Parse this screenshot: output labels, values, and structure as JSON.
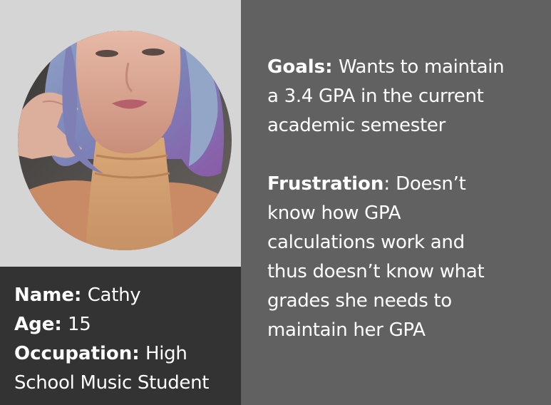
{
  "persona": {
    "name_label": "Name:",
    "name_value": "Cathy",
    "age_label": "Age:",
    "age_value": "15",
    "occupation_label": "Occupation:",
    "occupation_value_line1": "High",
    "occupation_value_line2": "School Music Student"
  },
  "goals": {
    "label": "Goals:",
    "line1": "Wants to maintain",
    "line2": "a 3.4 GPA in the current",
    "line3": "academic semester"
  },
  "frustration": {
    "label": "Frustration",
    "colon": ":",
    "line1": "Doesn’t",
    "line2": "know how GPA",
    "line3": "calculations work and",
    "line4": "thus doesn’t know what",
    "line5": "grades she needs to",
    "line6": "maintain her GPA"
  },
  "colors": {
    "panel_light": "#d5d5d5",
    "panel_dark": "#333333",
    "panel_mid": "#616161",
    "text": "#ffffff"
  },
  "icons": {
    "avatar": "persona-photo"
  }
}
